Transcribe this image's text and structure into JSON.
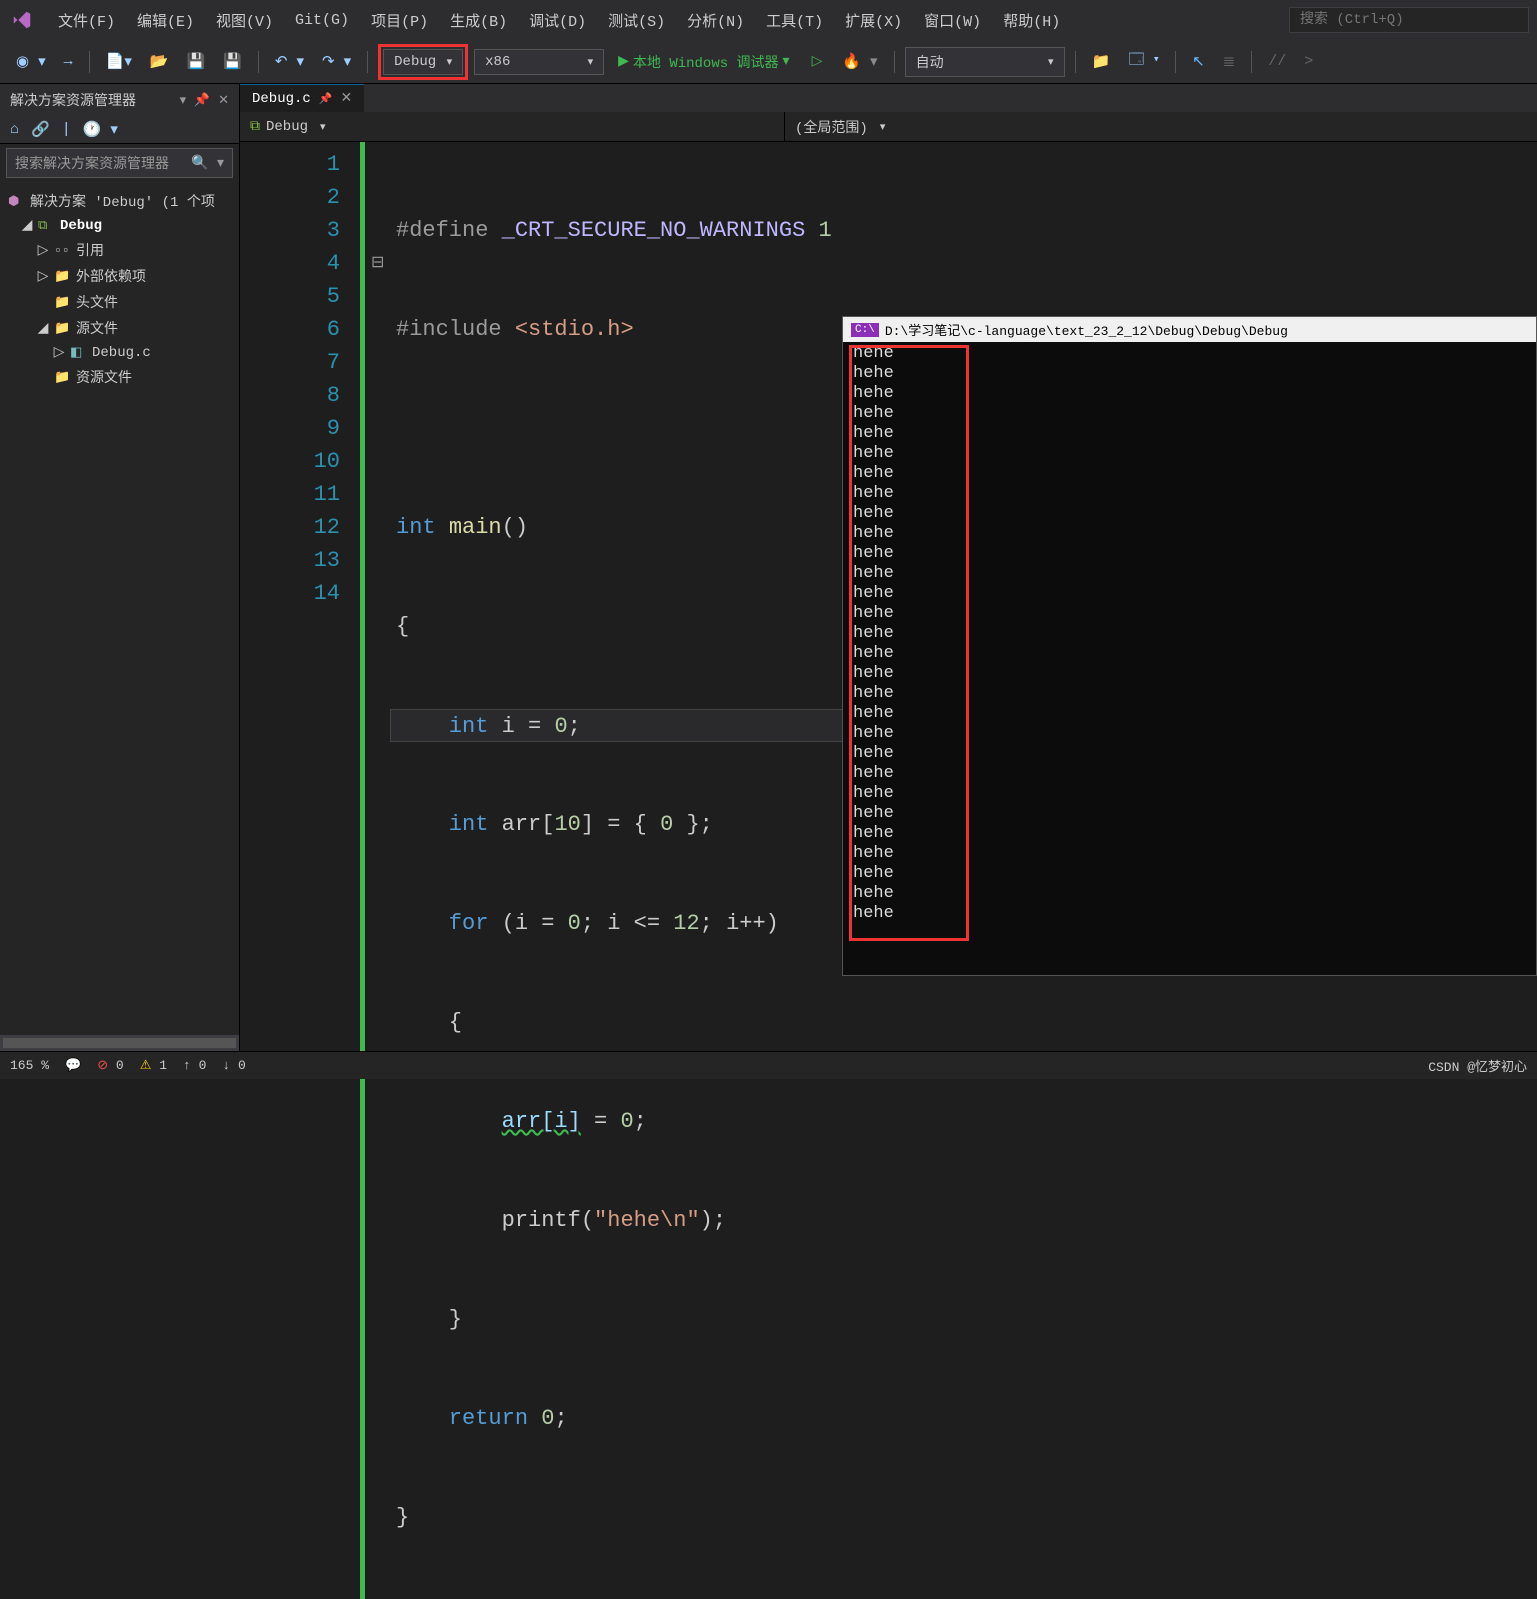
{
  "menu": {
    "file": "文件(F)",
    "edit": "编辑(E)",
    "view": "视图(V)",
    "git": "Git(G)",
    "project": "项目(P)",
    "build": "生成(B)",
    "debug": "调试(D)",
    "test": "测试(S)",
    "analyze": "分析(N)",
    "tools": "工具(T)",
    "extensions": "扩展(X)",
    "window": "窗口(W)",
    "help": "帮助(H)"
  },
  "search_placeholder": "搜索 (Ctrl+Q)",
  "toolbar": {
    "config": "Debug",
    "platform": "x86",
    "run": "本地 Windows 调试器",
    "auto": "自动"
  },
  "solution_explorer": {
    "title": "解决方案资源管理器",
    "search_placeholder": "搜索解决方案资源管理器",
    "solution": "解决方案 'Debug' (1 个项",
    "project": "Debug",
    "refs": "引用",
    "ext_deps": "外部依赖项",
    "headers": "头文件",
    "sources": "源文件",
    "source_file": "Debug.c",
    "resources": "资源文件"
  },
  "editor": {
    "tab": "Debug.c",
    "scope_left": "Debug",
    "scope_right": "(全局范围)",
    "lines": [
      "1",
      "2",
      "3",
      "4",
      "5",
      "6",
      "7",
      "8",
      "9",
      "10",
      "11",
      "12",
      "13",
      "14"
    ],
    "code": {
      "l1_a": "#define ",
      "l1_b": "_CRT_SECURE_NO_WARNINGS",
      "l1_c": " 1",
      "l2_a": "#include ",
      "l2_b": "<stdio.h>",
      "l4_a": "int ",
      "l4_b": "main",
      "l4_c": "()",
      "l5": "{",
      "l6_a": "    int ",
      "l6_b": "i = ",
      "l6_c": "0",
      "l6_d": ";",
      "l7_a": "    int ",
      "l7_b": "arr[",
      "l7_c": "10",
      "l7_d": "] = { ",
      "l7_e": "0",
      "l7_f": " };",
      "l8_a": "    for ",
      "l8_b": "(i = ",
      "l8_c": "0",
      "l8_d": "; i <= ",
      "l8_e": "12",
      "l8_f": "; i++)",
      "l9": "    {",
      "l10_a": "        ",
      "l10_b": "arr[i]",
      "l10_c": " = ",
      "l10_d": "0",
      "l10_e": ";",
      "l11_a": "        printf(",
      "l11_b": "\"hehe\\n\"",
      "l11_c": ");",
      "l12": "    }",
      "l13_a": "    return ",
      "l13_b": "0",
      "l13_c": ";",
      "l14": "}"
    }
  },
  "console": {
    "title": "D:\\学习笔记\\c-language\\text_23_2_12\\Debug\\Debug\\Debug",
    "output_line": "hehe",
    "output_count": 29
  },
  "status": {
    "zoom": "165 %",
    "errors": "0",
    "warnings": "1",
    "up": "↑ 0",
    "down": "↓ 0",
    "watermark": "CSDN @忆梦初心"
  }
}
